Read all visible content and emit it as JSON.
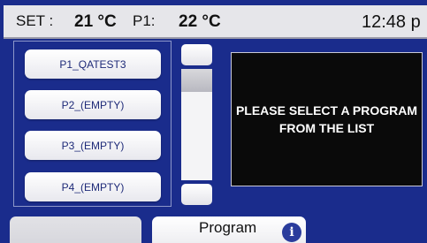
{
  "status_bar": {
    "set_label": "SET :",
    "set_value": "21 °C",
    "p1_label": "P1:",
    "p1_value": "22 °C",
    "clock": "12:48 p"
  },
  "program_list": {
    "items": [
      {
        "label": "P1_QATEST3"
      },
      {
        "label": "P2_(EMPTY)"
      },
      {
        "label": "P3_(EMPTY)"
      },
      {
        "label": "P4_(EMPTY)"
      }
    ]
  },
  "message": {
    "line1": "PLEASE SELECT A PROGRAM",
    "line2": "FROM THE LIST"
  },
  "tabs": {
    "left_label": "",
    "program_label": "Program",
    "info_icon": "info-icon"
  },
  "colors": {
    "screen_background": "#1a2c8c",
    "status_bar": "#e6e6ea",
    "message_background": "#0a0a0a",
    "button_text": "#1e2a78",
    "info_icon": "#2a3c9c"
  }
}
